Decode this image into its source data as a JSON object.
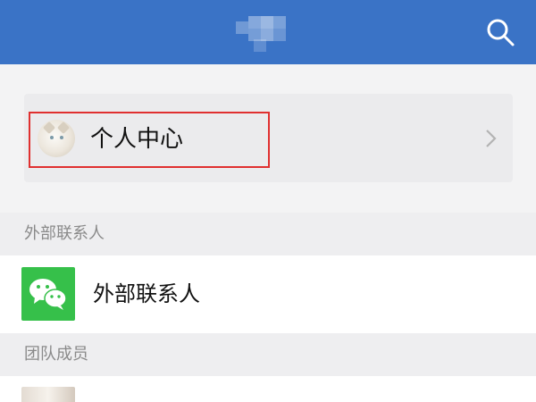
{
  "header": {
    "title_blurred": true,
    "search_icon": "search-icon",
    "background": "#3a73c6"
  },
  "profile": {
    "label": "个人中心",
    "avatar_icon": "cat-avatar",
    "chevron_icon": "chevron-right-icon",
    "highlight_color": "#e03030"
  },
  "sections": {
    "external_header": "外部联系人",
    "team_header": "团队成员"
  },
  "external_item": {
    "label": "外部联系人",
    "icon": "wechat-icon",
    "icon_color": "#36c04a"
  },
  "team_member": {
    "avatar_icon": "member-avatar"
  }
}
